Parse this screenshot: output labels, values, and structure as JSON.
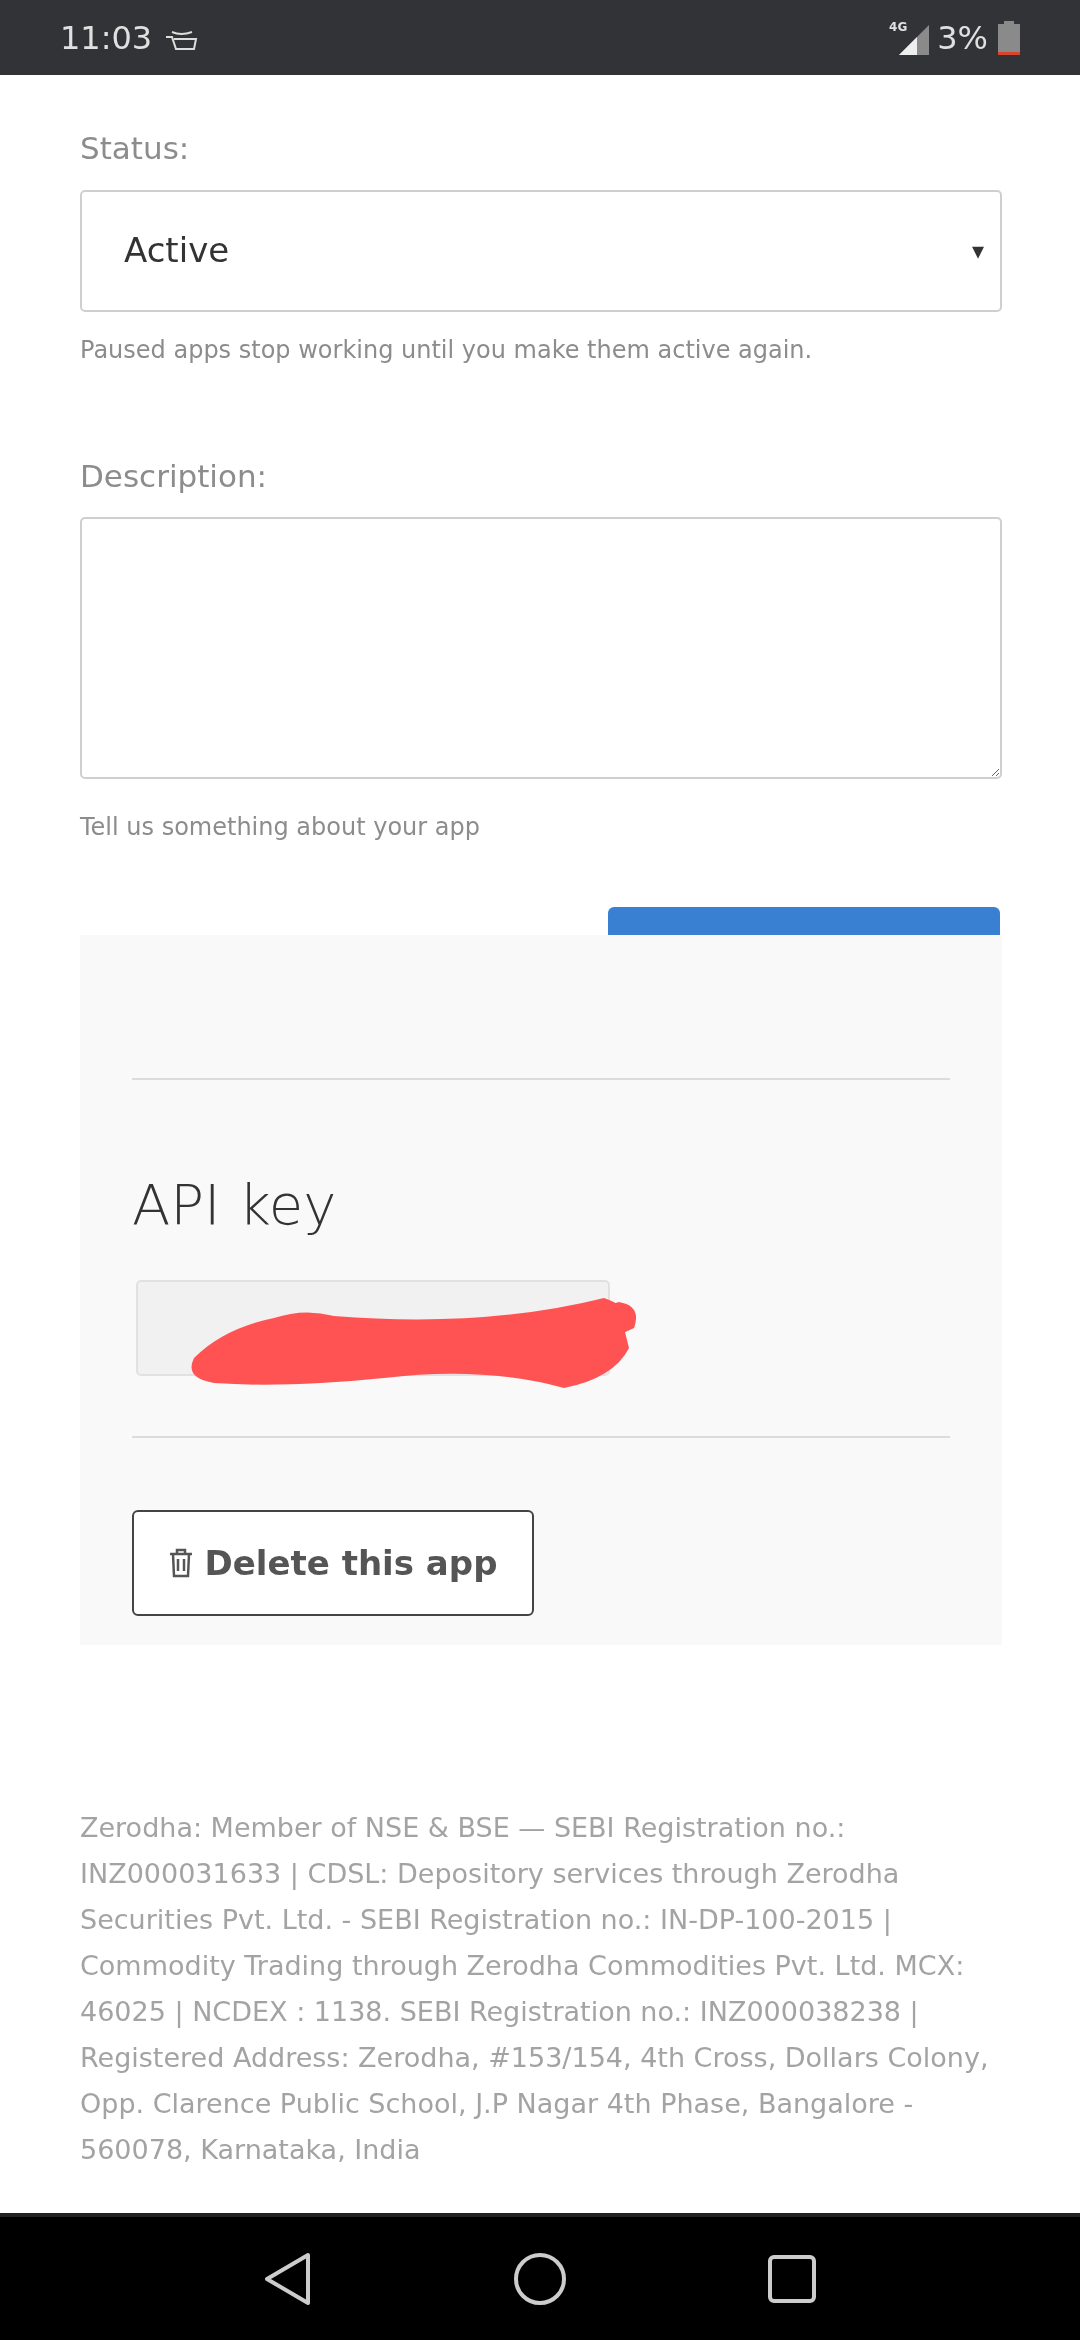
{
  "status_bar": {
    "time": "11:03",
    "network": "4G",
    "battery": "3%"
  },
  "status_field": {
    "label": "Status:",
    "value": "Active",
    "caret": "▾",
    "hint": "Paused apps stop working until you make them active again."
  },
  "description_field": {
    "label": "Description:",
    "hint": "Tell us something about your app"
  },
  "api_panel": {
    "title": "API key",
    "delete_button": "Delete this app"
  },
  "footer": "Zerodha: Member of NSE & BSE — SEBI Registration no.: INZ000031633 | CDSL: Depository services through Zerodha Securities Pvt. Ltd. - SEBI Registration no.: IN-DP-100-2015 | Commodity Trading through Zerodha Commodities Pvt. Ltd. MCX: 46025 | NCDEX : 1138. SEBI Registration no.: INZ000038238 | Registered Address: Zerodha, #153/154, 4th Cross, Dollars Colony, Opp. Clarence Public School, J.P Nagar 4th Phase, Bangalore - 560078, Karnataka, India"
}
